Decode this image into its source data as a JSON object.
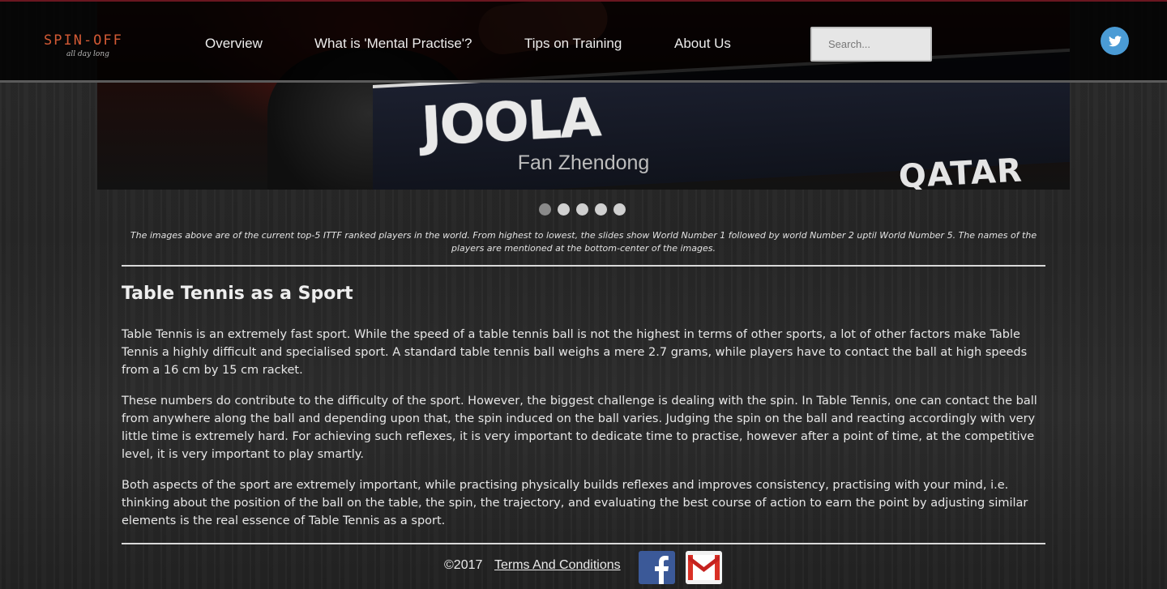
{
  "brand": {
    "name": "SPIN-OFF",
    "tagline": "all day long",
    "accent_color": "#d35a35"
  },
  "nav": {
    "items": [
      {
        "label": "Overview"
      },
      {
        "label": "What is 'Mental Practise'?"
      },
      {
        "label": "Tips on Training"
      },
      {
        "label": "About Us"
      }
    ]
  },
  "search": {
    "placeholder": "Search..."
  },
  "social": {
    "twitter_icon": "twitter-icon",
    "twitter_color": "#4a9bd5"
  },
  "slideshow": {
    "caption": "Fan Zhendong",
    "brand_text": "JOOLA",
    "sponsor_text": "QATAR OPEN",
    "active_index": 0,
    "slide_count": 5
  },
  "slide_note": "The images above are of the current top-5 ITTF ranked players in the world. From highest to lowest, the slides show World Number 1 followed by world Number 2 uptil World Number 5. The names of the players are mentioned at the bottom-center of the images.",
  "section": {
    "title": "Table Tennis as a Sport",
    "paragraphs": [
      "Table Tennis is an extremely fast sport. While the speed of a table tennis ball is not the highest in terms of other sports, a lot of other factors make Table Tennis a highly difficult and specialised sport. A standard table tennis ball weighs a mere 2.7 grams, while players have to contact the ball at high speeds from a 16 cm by 15 cm racket.",
      "These numbers do contribute to the difficulty of the sport. However, the biggest challenge is dealing with the spin. In Table Tennis, one can contact the ball from anywhere along the ball and depending upon that, the spin induced on the ball varies. Judging the spin on the ball and reacting accordingly with very little time is extremely hard. For achieving such reflexes, it is very important to dedicate time to practise, however after a point of time, at the competitive level, it is very important to play smartly.",
      "Both aspects of the sport are extremely important, while practising physically builds reflexes and improves consistency, practising with your mind, i.e. thinking about the position of the ball on the table, the spin, the trajectory, and evaluating the best course of action to earn the point by adjusting similar elements is the real essence of Table Tennis as a sport."
    ]
  },
  "footer": {
    "copyright": "©2017",
    "terms_label": "Terms And Conditions",
    "facebook_icon": "facebook-icon",
    "gmail_icon": "gmail-icon"
  }
}
